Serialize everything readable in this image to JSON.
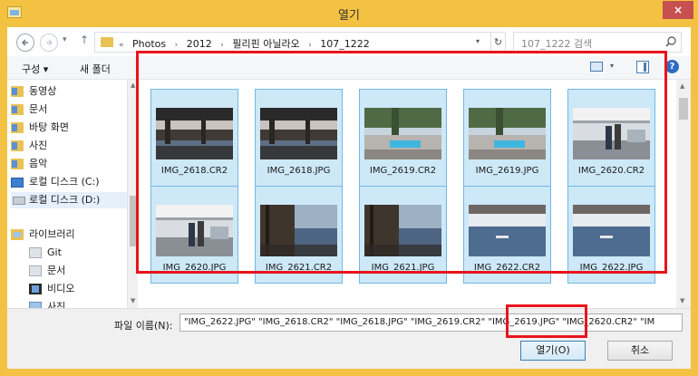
{
  "window": {
    "title": "열기",
    "close_label": "×"
  },
  "address": {
    "overflow": "«",
    "crumbs": [
      "Photos",
      "2012",
      "필리핀 아닐라오",
      "107_1222"
    ],
    "search_placeholder": "107_1222 검색"
  },
  "toolbar": {
    "organize_label": "구성 ▾",
    "new_folder_label": "새 폴더",
    "help_label": "?"
  },
  "nav": {
    "items": [
      {
        "label": "동영상",
        "icon": "video-folder-icon"
      },
      {
        "label": "문서",
        "icon": "documents-folder-icon"
      },
      {
        "label": "바탕 화면",
        "icon": "desktop-folder-icon"
      },
      {
        "label": "사진",
        "icon": "pictures-folder-icon"
      },
      {
        "label": "음악",
        "icon": "music-folder-icon"
      },
      {
        "label": "로컬 디스크 (C:)",
        "icon": "windows-drive-icon"
      },
      {
        "label": "로컬 디스크 (D:)",
        "icon": "drive-icon",
        "selected": true
      }
    ],
    "libraries": [
      {
        "label": "라이브러리",
        "icon": "library-icon"
      },
      {
        "label": "Git",
        "icon": "git-library-icon"
      },
      {
        "label": "문서",
        "icon": "documents-library-icon"
      },
      {
        "label": "비디오",
        "icon": "video-library-icon"
      },
      {
        "label": "사진",
        "icon": "pictures-library-icon"
      }
    ]
  },
  "files": [
    {
      "name": "IMG_2618.CR2",
      "scene": "sunset"
    },
    {
      "name": "IMG_2618.JPG",
      "scene": "sunset"
    },
    {
      "name": "IMG_2619.CR2",
      "scene": "pool"
    },
    {
      "name": "IMG_2619.JPG",
      "scene": "pool"
    },
    {
      "name": "IMG_2620.CR2",
      "scene": "porch"
    },
    {
      "name": "IMG_2620.JPG",
      "scene": "porch"
    },
    {
      "name": "IMG_2621.CR2",
      "scene": "shore"
    },
    {
      "name": "IMG_2621.JPG",
      "scene": "shore"
    },
    {
      "name": "IMG_2622.CR2",
      "scene": "sea"
    },
    {
      "name": "IMG_2622.JPG",
      "scene": "sea"
    }
  ],
  "bottom": {
    "filename_label": "파일 이름(N):",
    "filename_value": "\"IMG_2622.JPG\" \"IMG_2618.CR2\" \"IMG_2618.JPG\" \"IMG_2619.CR2\" \"IMG_2619.JPG\" \"IMG_2620.CR2\" \"IM",
    "open_label": "열기(O)",
    "cancel_label": "취소"
  },
  "colors": {
    "highlight_red": "#e8141c",
    "selection_fill": "#cde8f7",
    "selection_border": "#73b8e6",
    "title_bar": "#f4c242"
  }
}
